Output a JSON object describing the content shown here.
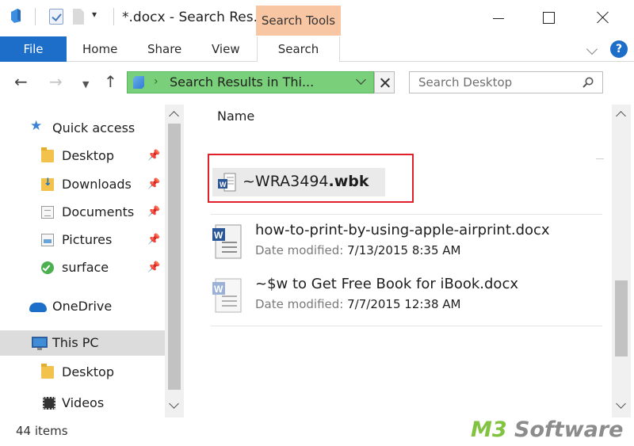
{
  "window": {
    "title": "*.docx - Search Res...",
    "contextual_tab": "Search Tools"
  },
  "ribbon": {
    "file": "File",
    "home": "Home",
    "share": "Share",
    "view": "View",
    "search": "Search",
    "help": "?"
  },
  "address": {
    "path": "Search Results in Thi...",
    "search_placeholder": "Search Desktop"
  },
  "nav": {
    "quick_access": "Quick access",
    "desktop": "Desktop",
    "downloads": "Downloads",
    "documents": "Documents",
    "pictures": "Pictures",
    "surface": "surface",
    "onedrive": "OneDrive",
    "this_pc": "This PC",
    "pc_desktop": "Desktop",
    "videos": "Videos"
  },
  "content": {
    "column_name": "Name",
    "highlighted_file": {
      "name_prefix": "~WRA3494",
      "name_ext": ".wbk"
    },
    "files": [
      {
        "name": "how-to-print-by-using-apple-airprint.docx",
        "date_label": "Date modified:",
        "date_value": "7/13/2015 8:35 AM"
      },
      {
        "name": "~$w to Get Free Book for iBook.docx",
        "date_label": "Date modified:",
        "date_value": "7/7/2015 12:38 AM"
      }
    ]
  },
  "status": {
    "items": "44 items"
  },
  "watermark": {
    "part1": "M3",
    "part2": " Software"
  },
  "colors": {
    "accent": "#1c6ec8",
    "address_bar": "#7ad07a",
    "search_tools_tab": "#f9c6a4",
    "highlight_border": "#e0202a"
  }
}
